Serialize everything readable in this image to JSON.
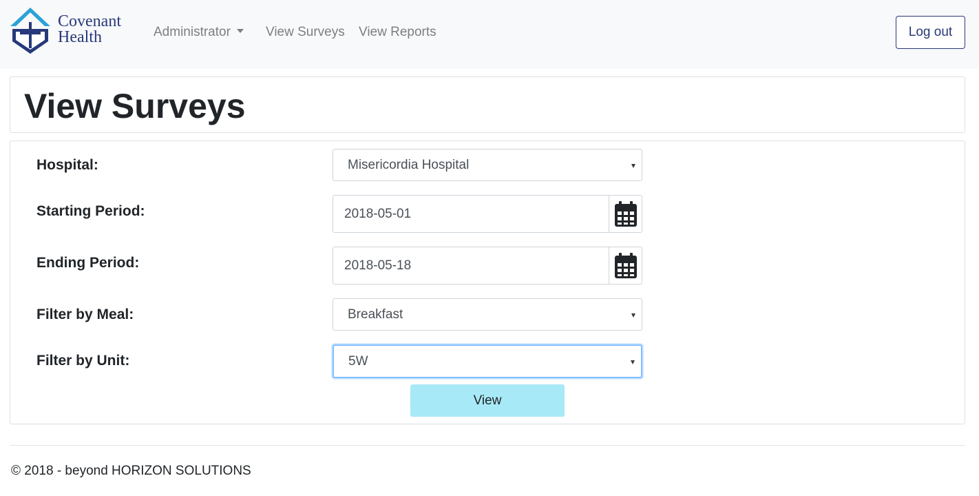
{
  "brand": {
    "line1": "Covenant",
    "line2": "Health",
    "icon": "covenant-cross-logo",
    "color": "#27397a",
    "accent": "#2aa3d8"
  },
  "nav": {
    "administrator": "Administrator",
    "view_surveys": "View Surveys",
    "view_reports": "View Reports",
    "logout": "Log out"
  },
  "page": {
    "title": "View Surveys"
  },
  "form": {
    "hospital": {
      "label": "Hospital:",
      "value": "Misericordia Hospital"
    },
    "start": {
      "label": "Starting Period:",
      "value": "2018-05-01",
      "icon": "calendar-icon"
    },
    "end": {
      "label": "Ending Period:",
      "value": "2018-05-18",
      "icon": "calendar-icon"
    },
    "meal": {
      "label": "Filter by Meal:",
      "value": "Breakfast"
    },
    "unit": {
      "label": "Filter by Unit:",
      "value": "5W"
    },
    "submit": "View"
  },
  "footer": {
    "text": "© 2018 - beyond HORIZON SOLUTIONS"
  }
}
